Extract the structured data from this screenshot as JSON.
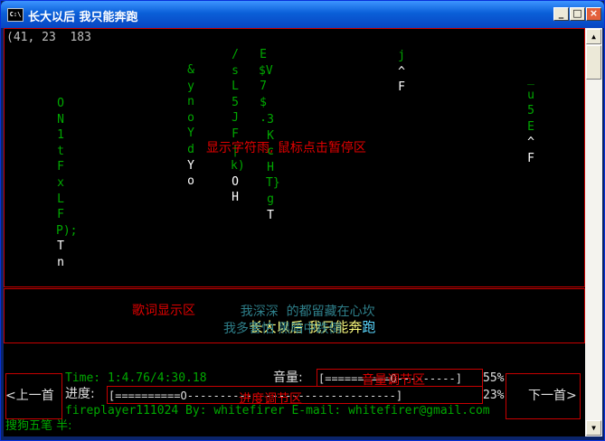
{
  "window": {
    "title": "长大以后 我只能奔跑",
    "icon_text": "C:\\",
    "minimize": "_",
    "maximize": "□",
    "close": "×"
  },
  "console": {
    "header_text": "(41, 23  183",
    "char_rain": [
      {
        "trail": "ON1tFxLFP);",
        "head": "T",
        "tail": "n"
      },
      {
        "trail": "&ynoYd",
        "head": "Y",
        "tail": "o"
      },
      {
        "trail": "/sL5JF|k)",
        "head": "O",
        "tail": "H"
      },
      {
        "trail": "E$V7",
        "head": "$",
        "tail": "."
      },
      {
        "trail": "3KcHT}g",
        "head": "T",
        "tail": ""
      },
      {
        "trail": "j",
        "head": "^",
        "tail": "F"
      },
      {
        "trail": "_u5E",
        "head": "^",
        "tail": "F"
      }
    ],
    "rain_area_label": "显示字符雨, 鼠标点击暂停区",
    "lyrics_area_label": "歌词显示区",
    "lyrics": {
      "prev_a": "我深深",
      "prev_b": "的都留藏在心坎",
      "current_sung": "长大以后 我只能奔",
      "current_rest": "跑",
      "next": "我多害怕 黑暗中跌倒"
    },
    "prev_button": "<上一首",
    "next_button": "下一首>",
    "time_text": "Time: 1:4.76/4:30.18",
    "volume_label": "音量:",
    "volume_bar": "[==========O---------]",
    "volume_percent": "55%",
    "volume_area_label": "音量调节区",
    "progress_label": "进度:",
    "progress_bar": "[==========O--------------------------------]",
    "progress_percent": "23%",
    "progress_area_label": "进度调节区",
    "credits": "fireplayer111024 By: whitefirer E-mail: whitefirer@gmail.com",
    "ime_status": "搜狗五笔 半:"
  },
  "colors": {
    "rain_trail": "#00a800",
    "rain_head": "#ffffff",
    "region_border": "#c80000",
    "lyric_dim": "#2e7f8a",
    "lyric_current": "#ffff80",
    "lyric_highlight": "#5ad7ff"
  }
}
